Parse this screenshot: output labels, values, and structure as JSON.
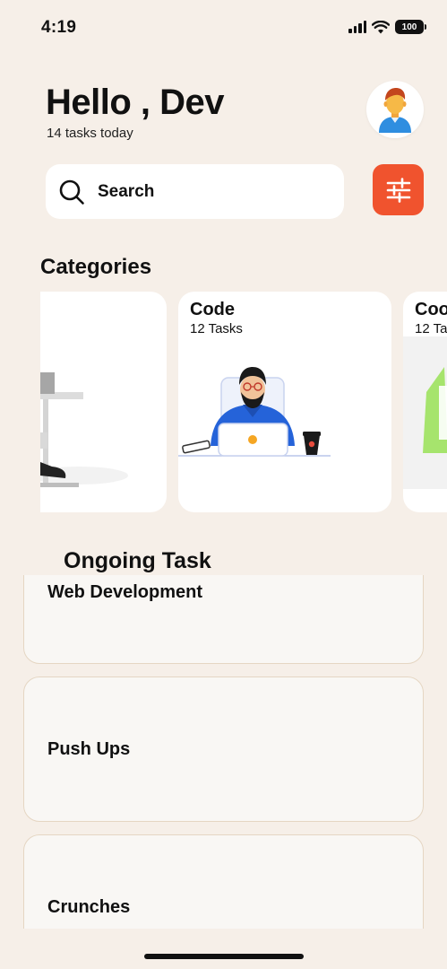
{
  "status_bar": {
    "time": "4:19",
    "battery": "100"
  },
  "header": {
    "greeting": "Hello , Dev",
    "subtitle": "14 tasks today",
    "avatar_icon": "person-avatar-icon"
  },
  "search": {
    "label": "Search",
    "icon": "search-icon",
    "filter_icon": "sliders-icon"
  },
  "colors": {
    "background": "#f6efe8",
    "accent": "#f0532e",
    "card": "#ffffff",
    "task_border": "#e5d6c3"
  },
  "categories": {
    "title": "Categories",
    "items": [
      {
        "title": "",
        "count": ""
      },
      {
        "title": "Code",
        "count": "12 Tasks"
      },
      {
        "title": "Coo",
        "count": "12 Ta"
      }
    ]
  },
  "ongoing": {
    "title": "Ongoing Task",
    "tasks": [
      {
        "label": "Web Development"
      },
      {
        "label": "Push Ups"
      },
      {
        "label": "Crunches"
      }
    ]
  }
}
